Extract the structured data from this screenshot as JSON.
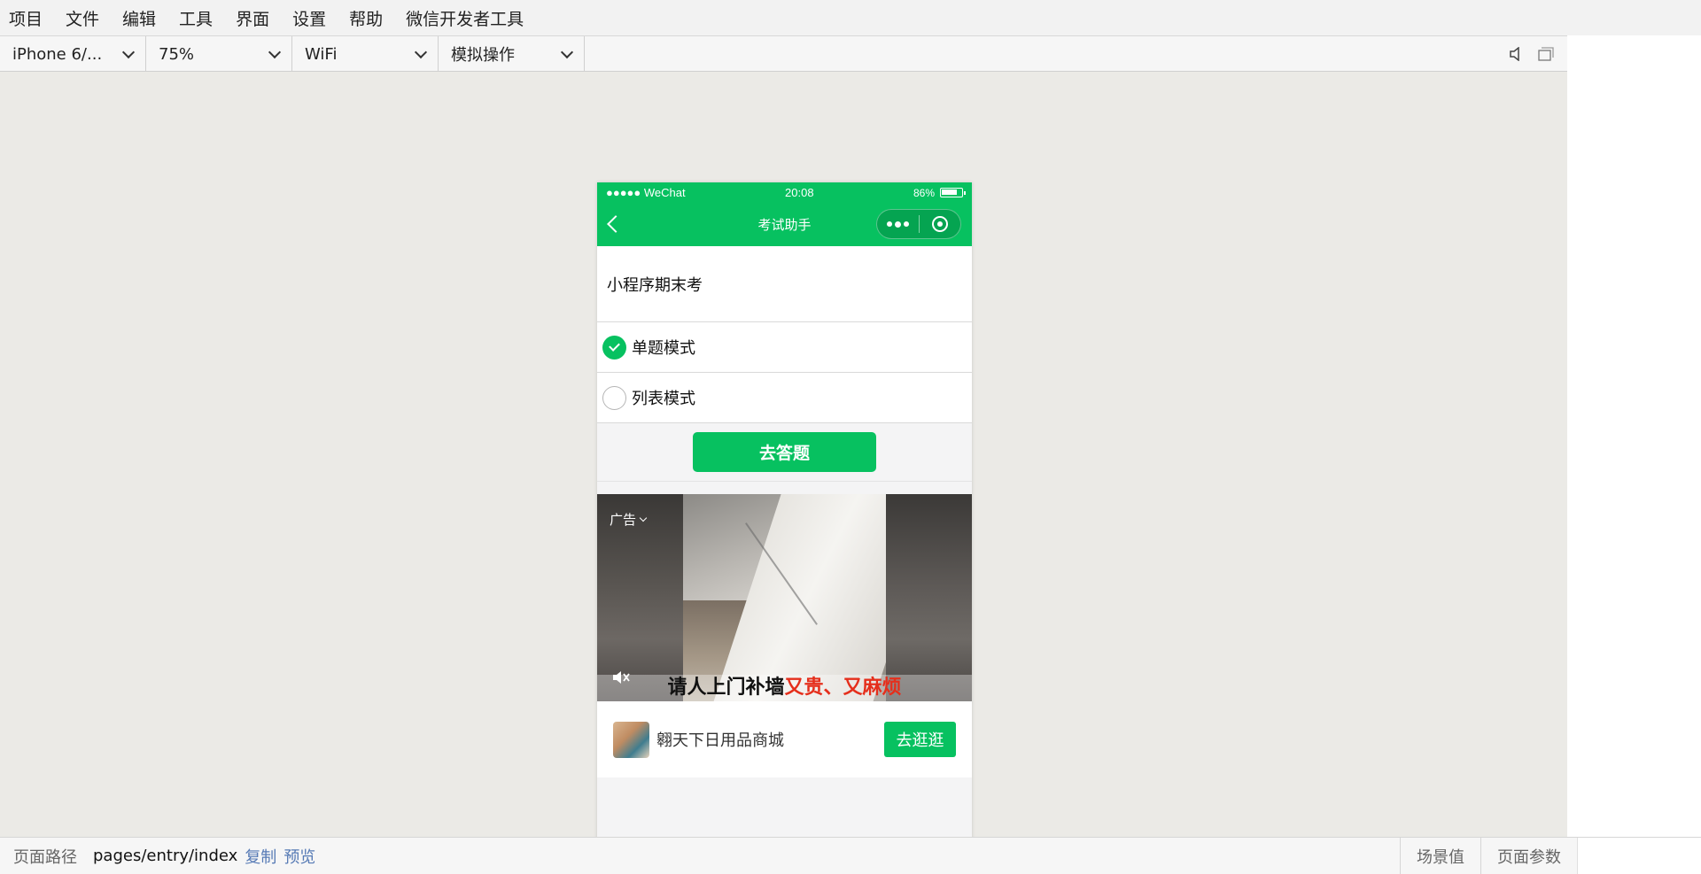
{
  "menubar": {
    "items": [
      "项目",
      "文件",
      "编辑",
      "工具",
      "界面",
      "设置",
      "帮助",
      "微信开发者工具"
    ]
  },
  "toolbar": {
    "device": "iPhone 6/...",
    "zoom": "75%",
    "network": "WiFi",
    "operation": "模拟操作",
    "icons": [
      "speaker-icon",
      "window-icon"
    ]
  },
  "phone": {
    "status": {
      "signal": "●●●●● WeChat",
      "time": "20:08",
      "battery": "86%",
      "battery_level": 0.86
    },
    "navbar": {
      "title": "考试助手"
    },
    "exam_title": "小程序期末考",
    "modes": [
      {
        "label": "单题模式",
        "checked": true
      },
      {
        "label": "列表模式",
        "checked": false
      }
    ],
    "start_button": "去答题",
    "ad": {
      "label": "广告",
      "caption_main": "请人上门补墙",
      "caption_highlight": "又贵、又麻烦",
      "brand": "翱天下日用品商城",
      "cta": "去逛逛",
      "highlight_color": "#e52f1c"
    }
  },
  "footer": {
    "path_label": "页面路径",
    "path": "pages/entry/index",
    "copy": "复制",
    "preview": "预览",
    "scene": "场景值",
    "params": "页面参数"
  },
  "colors": {
    "accent": "#07c160",
    "link": "#567ab5",
    "canvas": "#ebeae6"
  }
}
